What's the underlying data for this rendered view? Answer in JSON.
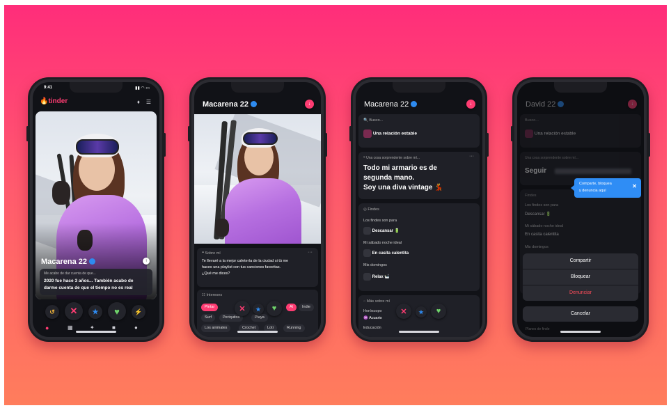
{
  "phone1": {
    "time": "9:41",
    "brand": "tinder",
    "profile_name": "Macarena 22",
    "prompt_label": "Me acabo de dar cuenta de que...",
    "prompt_text_1": "2020 fue hace 3 años... También acabo de",
    "prompt_text_2": "darme cuenta de que el tiempo no es real"
  },
  "phone2": {
    "profile_name": "Macarena 22",
    "about_label": "Sobre mí",
    "about_text_1": "Te llevaré a la mejor cafetería de la ciudad si tú me",
    "about_text_2": "haces una playlist con tus canciones favoritas.",
    "about_text_3": "¿Qué me dices?",
    "interests_label": "Intereses",
    "chips": [
      "Pintar",
      "Indie",
      "Surf",
      "Periquitos",
      "Playa",
      "Los animales",
      "Crochet",
      "Lotr",
      "Running"
    ]
  },
  "phone3": {
    "profile_name": "Macarena 22",
    "looking_label": "Busco...",
    "looking_value": "Una relación estable",
    "surprise_label": "Una cosa sorprendente sobre mí...",
    "surprise_line_1": "Todo mi armario es de",
    "surprise_line_2": "segunda mano.",
    "surprise_line_3": "Soy una diva vintage 💃",
    "weekends_label": "Findes",
    "weekends_q1": "Los findes son para",
    "weekends_a1": "Descansar 🔋",
    "weekends_q2": "Mi sábado noche ideal",
    "weekends_a2": "En casita calentita",
    "weekends_q3": "Mis domingos",
    "weekends_a3": "Relax 🛀",
    "more_label": "Más sobre mí",
    "horoscope_label": "Horóscopo",
    "horoscope_value": "Acuario",
    "education_label": "Educación"
  },
  "phone4": {
    "profile_name": "David 22",
    "looking_label": "Busco...",
    "looking_value": "Una relación estable",
    "surprise_label": "Una cosa sorprendente sobre mí...",
    "follow_text": "Seguir",
    "tooltip_text_1": "Comparte, bloquea",
    "tooltip_text_2": "y denuncia aquí",
    "tooltip_close": "✕",
    "weekends_label": "Findes",
    "weekends_q1": "Los findes son para",
    "weekends_a1": "Descansar 🔋",
    "weekends_q2": "Mi sábado noche ideal",
    "weekends_a2": "En casita calentita",
    "weekends_q3": "Mis domingos",
    "sheet_share": "Compartir",
    "sheet_block": "Bloquear",
    "sheet_report": "Denunciar",
    "sheet_cancel": "Cancelar",
    "more_label": "Planes de finde"
  },
  "colors": {
    "brand_red": "#fe3c72",
    "like_green": "#6fd36a",
    "superlike_blue": "#2e8bf0",
    "report_red": "#ff4d5a",
    "tooltip_blue": "#2f8df5"
  }
}
